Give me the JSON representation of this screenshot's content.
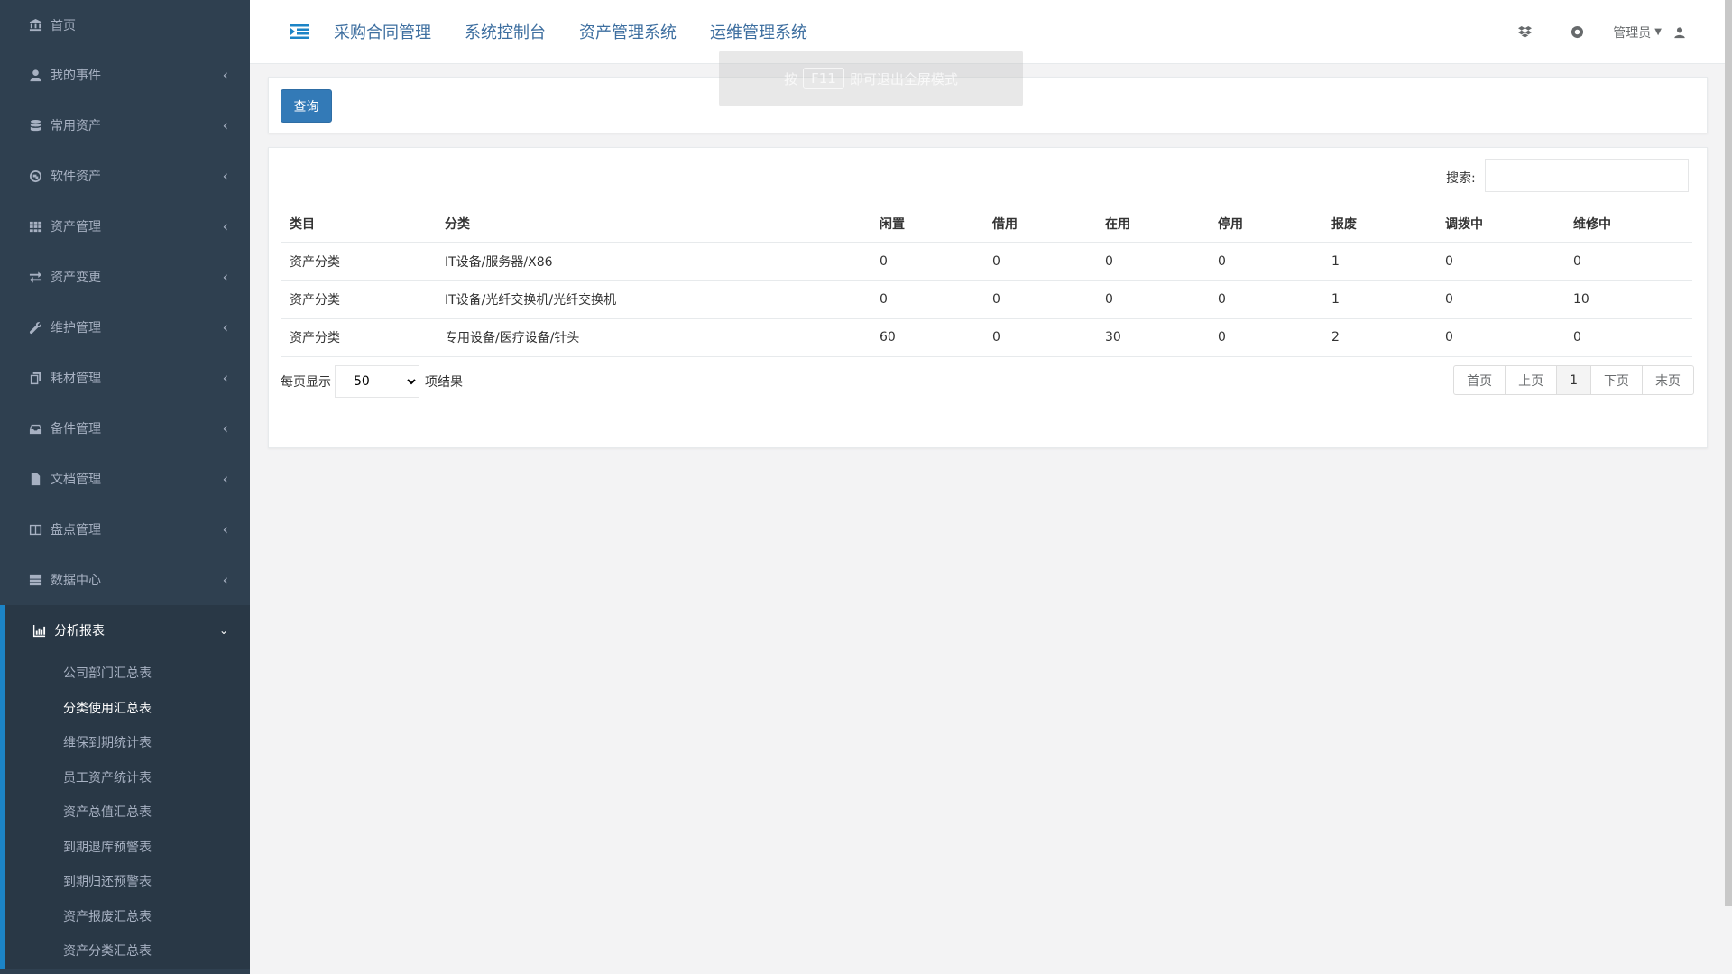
{
  "sidebar": {
    "home": "首页",
    "items": [
      {
        "label": "我的事件"
      },
      {
        "label": "常用资产"
      },
      {
        "label": "软件资产"
      },
      {
        "label": "资产管理"
      },
      {
        "label": "资产变更"
      },
      {
        "label": "维护管理"
      },
      {
        "label": "耗材管理"
      },
      {
        "label": "备件管理"
      },
      {
        "label": "文档管理"
      },
      {
        "label": "盘点管理"
      },
      {
        "label": "数据中心"
      }
    ],
    "active_group": {
      "label": "分析报表",
      "subitems": [
        "公司部门汇总表",
        "分类使用汇总表",
        "维保到期统计表",
        "员工资产统计表",
        "资产总值汇总表",
        "到期退库预警表",
        "到期归还预警表",
        "资产报废汇总表",
        "资产分类汇总表"
      ],
      "current_index": 1
    }
  },
  "topbar": {
    "links": [
      "采购合同管理",
      "系统控制台",
      "资产管理系统",
      "运维管理系统"
    ],
    "admin_label": "管理员"
  },
  "toast": {
    "pre": "按",
    "key": "F11",
    "post": "即可退出全屏模式"
  },
  "query_button": "查询",
  "search": {
    "label": "搜索:",
    "value": ""
  },
  "table": {
    "headers": [
      "类目",
      "分类",
      "闲置",
      "借用",
      "在用",
      "停用",
      "报废",
      "调拨中",
      "维修中"
    ],
    "rows": [
      [
        "资产分类",
        "IT设备/服务器/X86",
        "0",
        "0",
        "0",
        "0",
        "1",
        "0",
        "0"
      ],
      [
        "资产分类",
        "IT设备/光纤交换机/光纤交换机",
        "0",
        "0",
        "0",
        "0",
        "1",
        "0",
        "10"
      ],
      [
        "资产分类",
        "专用设备/医疗设备/针头",
        "60",
        "0",
        "30",
        "0",
        "2",
        "0",
        "0"
      ]
    ]
  },
  "pagination": {
    "per_page_prefix": "每页显示",
    "per_page_value": "50",
    "per_page_suffix": "项结果",
    "buttons": [
      "首页",
      "上页",
      "1",
      "下页",
      "末页"
    ],
    "active": "1"
  }
}
